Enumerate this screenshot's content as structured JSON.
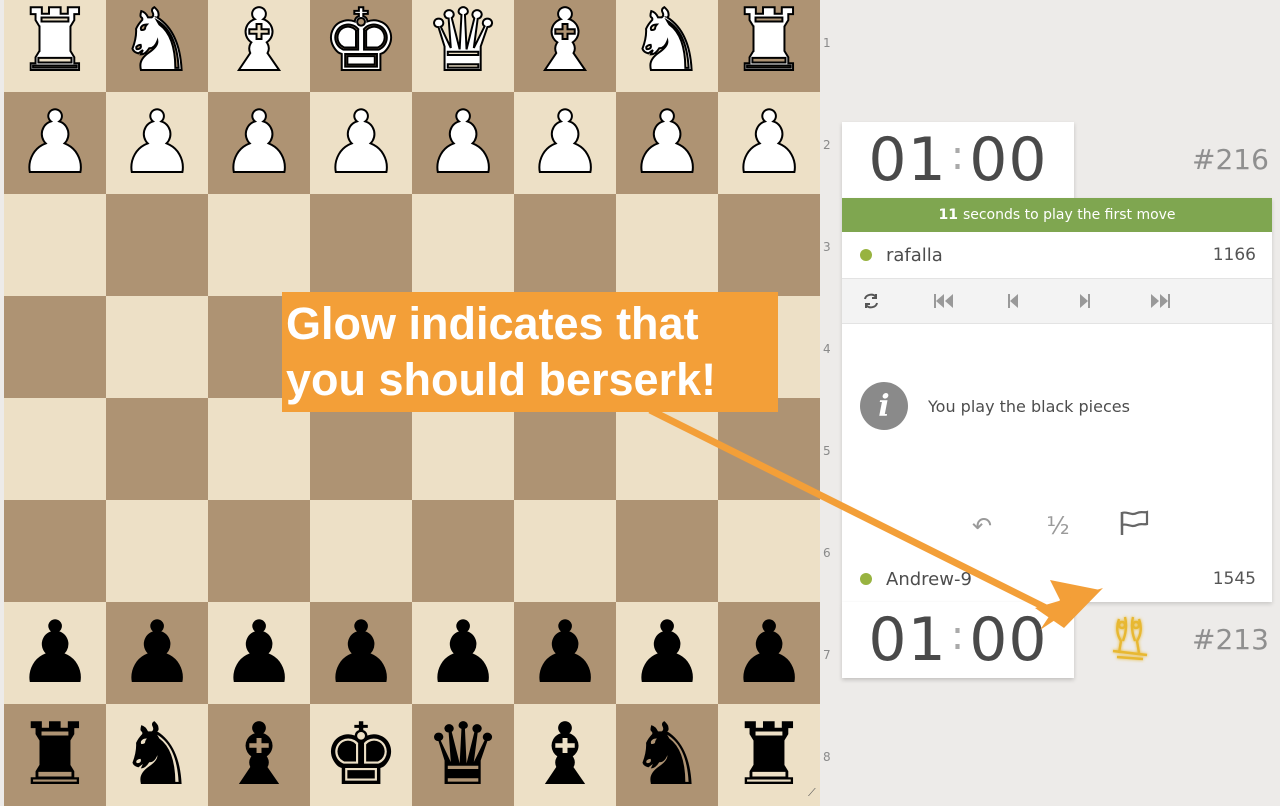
{
  "board": {
    "ranks": [
      [
        "♜",
        "♞",
        "♝",
        "♚",
        "♛",
        "♝",
        "♞",
        "♜"
      ],
      [
        "♟",
        "♟",
        "♟",
        "♟",
        "♟",
        "♟",
        "♟",
        "♟"
      ],
      [
        "",
        "",
        "",
        "",
        "",
        "",
        "",
        ""
      ],
      [
        "",
        "",
        "",
        "",
        "",
        "",
        "",
        ""
      ],
      [
        "",
        "",
        "",
        "",
        "",
        "",
        "",
        ""
      ],
      [
        "",
        "",
        "",
        "",
        "",
        "",
        "",
        ""
      ],
      [
        "♟",
        "♟",
        "♟",
        "♟",
        "♟",
        "♟",
        "♟",
        "♟"
      ],
      [
        "♜",
        "♞",
        "♝",
        "♚",
        "♛",
        "♝",
        "♞",
        "♜"
      ]
    ],
    "piece_colors": [
      "w",
      "w",
      "",
      "",
      "",
      "",
      "b",
      "b"
    ],
    "rank_labels": [
      "1",
      "2",
      "3",
      "4",
      "5",
      "6",
      "7",
      "8"
    ],
    "light_color": "#ede0c6",
    "dark_color": "#ae9373"
  },
  "opponent": {
    "clock_minutes": "01",
    "clock_seconds": "00",
    "rank": "#216",
    "name": "rafalla",
    "rating": "1166"
  },
  "player": {
    "clock_minutes": "01",
    "clock_seconds": "00",
    "rank": "#213",
    "name": "Andrew-9",
    "rating": "1545"
  },
  "banner": {
    "seconds": "11",
    "text": "seconds to play the first move",
    "color": "#7fa650"
  },
  "controls": {
    "flip_icon": "flip-board-icon",
    "first_icon": "first-move-icon",
    "prev_icon": "prev-move-icon",
    "next_icon": "next-move-icon",
    "last_icon": "last-move-icon"
  },
  "info": {
    "icon_glyph": "i",
    "message": "You play the black pieces"
  },
  "actions": {
    "takeback": "↶",
    "draw": "½",
    "resign_icon": "flag-icon"
  },
  "callout": {
    "line1": "Glow indicates that",
    "line2": "you should berserk!",
    "color": "#f39f38"
  },
  "berserk": {
    "icon": "berserk-icon",
    "glow_color": "#f0c040"
  }
}
